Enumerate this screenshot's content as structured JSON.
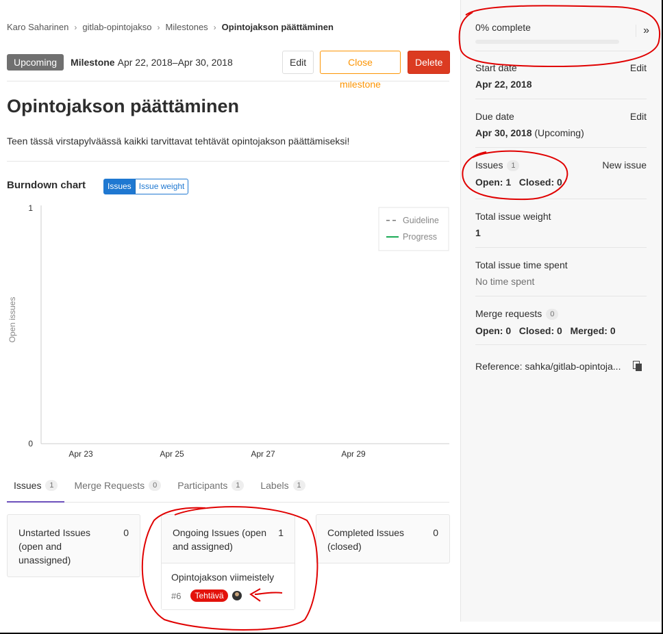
{
  "breadcrumb": {
    "items": [
      "Karo Saharinen",
      "gitlab-opintojakso",
      "Milestones"
    ],
    "current": "Opintojakson päättäminen"
  },
  "header": {
    "status": "Upcoming",
    "milestone_label": "Milestone",
    "dates": "Apr 22, 2018–Apr 30, 2018",
    "edit_label": "Edit",
    "close_label": "Close milestone",
    "delete_label": "Delete"
  },
  "title": "Opintojakson päättäminen",
  "description": "Teen tässä virstapylväässä kaikki tarvittavat tehtävät opintojakson päättämiseksi!",
  "burndown": {
    "title": "Burndown chart",
    "toggle_issues": "Issues",
    "toggle_weight": "Issue weight"
  },
  "chart_data": {
    "type": "line",
    "ylabel": "Open issues",
    "ylim": [
      0,
      1
    ],
    "yticks": [
      "0",
      "1"
    ],
    "xticks": [
      "Apr 23",
      "Apr 25",
      "Apr 27",
      "Apr 29"
    ],
    "legend_position": "top-right",
    "series": [
      {
        "name": "Guideline",
        "style": "dashed",
        "color": "#999999",
        "values": []
      },
      {
        "name": "Progress",
        "style": "solid",
        "color": "#1aaa55",
        "values": []
      }
    ]
  },
  "tabs": [
    {
      "label": "Issues",
      "count": "1"
    },
    {
      "label": "Merge Requests",
      "count": "0"
    },
    {
      "label": "Participants",
      "count": "1"
    },
    {
      "label": "Labels",
      "count": "1"
    }
  ],
  "boards": {
    "unstarted": {
      "title": "Unstarted Issues (open and unassigned)",
      "count": "0"
    },
    "ongoing": {
      "title": "Ongoing Issues (open and assigned)",
      "count": "1"
    },
    "completed": {
      "title": "Completed Issues (closed)",
      "count": "0"
    },
    "ongoing_issue": {
      "title": "Opintojakson viimeistely",
      "number": "#6",
      "label": "Tehtävä",
      "label_color": "#e3120b"
    }
  },
  "sidebar": {
    "progress_text": "0% complete",
    "progress_fraction": 0,
    "start_label": "Start date",
    "start_edit": "Edit",
    "start_value": "Apr 22, 2018",
    "due_label": "Due date",
    "due_edit": "Edit",
    "due_value": "Apr 30, 2018",
    "due_status": "(Upcoming)",
    "issues_label": "Issues",
    "issues_count": "1",
    "new_issue": "New issue",
    "issues_open": "Open: 1",
    "issues_closed": "Closed: 0",
    "weight_label": "Total issue weight",
    "weight_value": "1",
    "time_label": "Total issue time spent",
    "time_value": "No time spent",
    "mr_label": "Merge requests",
    "mr_count": "0",
    "mr_open": "Open: 0",
    "mr_closed": "Closed: 0",
    "mr_merged": "Merged: 0",
    "reference": "Reference: sahka/gitlab-opintoja..."
  },
  "colors": {
    "annotation": "#e00000",
    "accent": "#1f78d1",
    "delete": "#db3b21",
    "close": "#fc9403"
  }
}
